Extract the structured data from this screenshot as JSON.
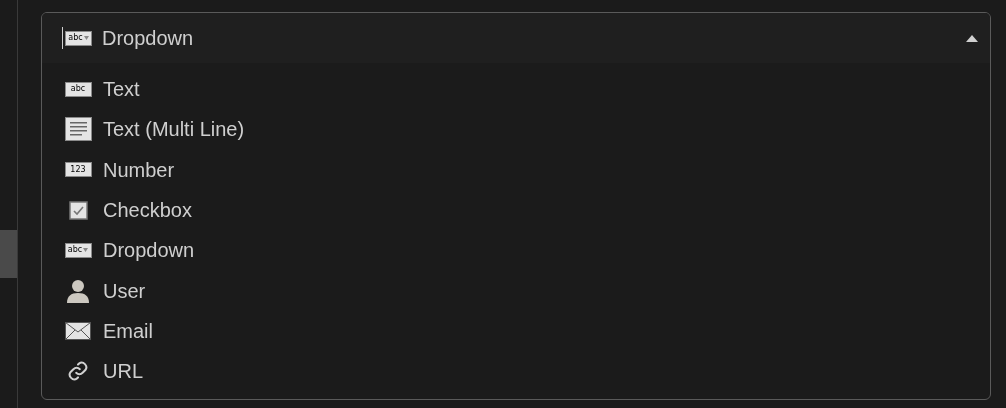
{
  "dropdown": {
    "value": "Dropdown",
    "kind": "dropdown",
    "icon_text": "abc",
    "expanded": true
  },
  "options": [
    {
      "label": "Text",
      "kind": "text",
      "icon_text": "abc"
    },
    {
      "label": "Text (Multi Line)",
      "kind": "multiline"
    },
    {
      "label": "Number",
      "kind": "number",
      "icon_text": "123"
    },
    {
      "label": "Checkbox",
      "kind": "checkbox"
    },
    {
      "label": "Dropdown",
      "kind": "dropdown",
      "icon_text": "abc"
    },
    {
      "label": "User",
      "kind": "user"
    },
    {
      "label": "Email",
      "kind": "email"
    },
    {
      "label": "URL",
      "kind": "url"
    }
  ]
}
